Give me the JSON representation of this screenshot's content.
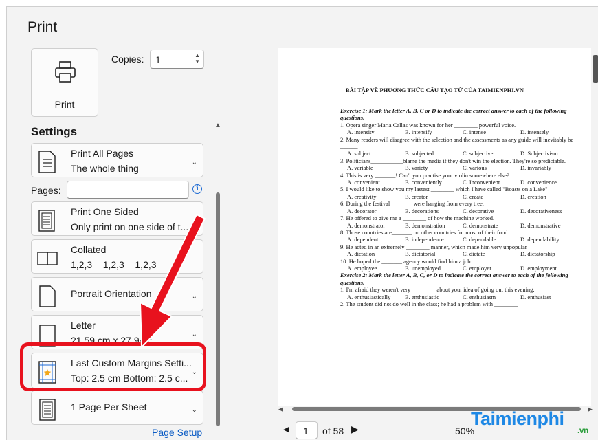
{
  "title": "Print",
  "print_button": {
    "label": "Print"
  },
  "copies": {
    "label": "Copies:",
    "value": "1"
  },
  "settings_heading": "Settings",
  "cards": [
    {
      "line1": "Print All Pages",
      "line2": "The whole thing",
      "icon": "document-pages-icon"
    },
    {
      "line1": "Print One Sided",
      "line2": "Only print on one side of t...",
      "icon": "one-sided-icon"
    },
    {
      "line1": "Collated",
      "line2": "1,2,3    1,2,3    1,2,3",
      "icon": "collated-icon"
    },
    {
      "line1": "Portrait Orientation",
      "line2": "",
      "icon": "portrait-icon"
    },
    {
      "line1": "Letter",
      "line2": "21.59 cm x 27.94 c",
      "icon": "letter-icon"
    },
    {
      "line1": "Last Custom Margins Setti...",
      "line2": "Top: 2.5 cm Bottom: 2.5 c...",
      "icon": "margins-icon"
    },
    {
      "line1": "1 Page Per Sheet",
      "line2": "",
      "icon": "sheet-icon"
    }
  ],
  "pages": {
    "label": "Pages:",
    "value": ""
  },
  "page_setup": "Page Setup",
  "preview": {
    "title": "BÀI TẬP VỀ PHƯƠNG THỨC CẤU TẠO TỪ CỦA TAIMIENPHI.VN",
    "ex1": "Exercise 1: Mark the letter A, B, C or D to indicate the correct answer to each of the following questions.",
    "ex2": "Exercise 2: Mark the letter A, B, C, or D to indicate the correct answer to each of the following questions.",
    "questions": [
      {
        "q": "1.  Opera singer Maria Callas was known for her ________ powerful voice.",
        "opts": [
          "A. intensity",
          "B. intensify",
          "C. intense",
          "D. intensely"
        ]
      },
      {
        "q": "2. Many readers will disagree with the selection and the assessments as any guide will inevitably be ______",
        "opts": [
          "A. subject",
          "B. subjected",
          "C. subjective",
          "D. Subjectivism"
        ]
      },
      {
        "q": "3. Politicians___________blame the media if they don't win the election. They're so predictable.",
        "opts": [
          "A. variable",
          "B. variety",
          "C. various",
          "D. invariably"
        ]
      },
      {
        "q": "4. This is very _______! Can't you practise your violin somewhere else?",
        "opts": [
          "A. convenient",
          "B. conveniently",
          "C. Inconvenient",
          "D. convenience"
        ]
      },
      {
        "q": "5. I would like to show you my lastest ________ which I have called \"Boasts on a Lake\"",
        "opts": [
          "A. creativity",
          "B. creator",
          "C. create",
          "D. creation"
        ]
      },
      {
        "q": "6. During the festival _______ were hanging from every tree.",
        "opts": [
          "A. decorator",
          "B. decorations",
          "C. decorative",
          "D. decorativeness"
        ]
      },
      {
        "q": "7. He offered to give me a ________ of how the machine worked.",
        "opts": [
          "A. demonstrator",
          "B. demonstration",
          "C. demonstrate",
          "D. demonstrative"
        ]
      },
      {
        "q": "8. Those countries are_______ on other countries for most of their food.",
        "opts": [
          "A. dependent",
          "B. independence",
          "C. dependable",
          "D. dependability"
        ]
      },
      {
        "q": "9. He acted in an extremely ________ manner, which made him very unpopular",
        "opts": [
          "A. dictation",
          "B. dictatorial",
          "C. dictate",
          "D. dictatorship"
        ]
      },
      {
        "q": "10. He hoped the _______ agency would find him a job.",
        "opts": [
          "A. employee",
          "B. unemployed",
          "C. employer",
          "D. employment"
        ]
      }
    ],
    "ex2_questions": [
      {
        "q": "1.  I'm afraid they weren't very ________ about your idea of going out this evening.",
        "opts": [
          "A. enthusiastically",
          "B. enthusiastic",
          "C. enthusiasm",
          "D. enthusiast"
        ]
      },
      {
        "q": "2.  The student did not do well in the class; he had a problem with ________",
        "opts": []
      }
    ]
  },
  "pager": {
    "current": "1",
    "of": "of 58",
    "zoom": "50%"
  },
  "watermark": {
    "main": "Taimienphi",
    "suffix": ".vn"
  },
  "colors": {
    "highlight": "#e8121e",
    "link": "#0a5bc4",
    "accent": "#1c6ad4"
  }
}
